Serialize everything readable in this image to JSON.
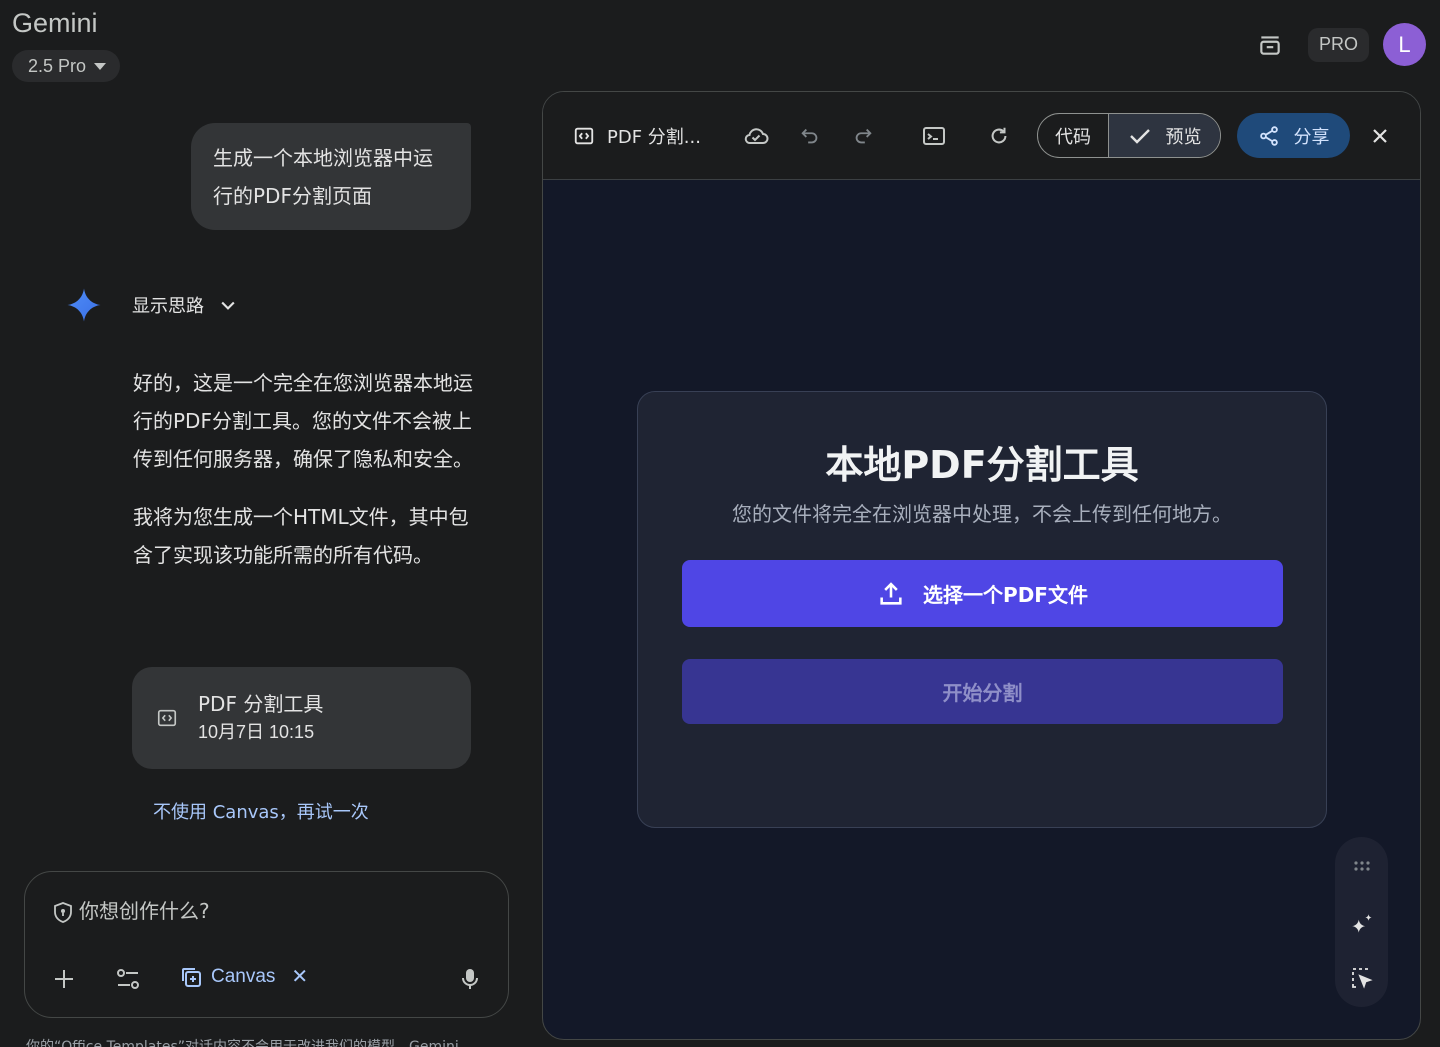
{
  "app": {
    "title": "Gemini",
    "model": "2.5 Pro",
    "pro_badge": "PRO",
    "avatar_letter": "L"
  },
  "chat": {
    "user_message": "生成一个本地浏览器中运行的PDF分割页面",
    "thoughts_label": "显示思路",
    "reply_paragraphs": [
      "好的，这是一个完全在您浏览器本地运行的PDF分割工具。您的文件不会被上传到任何服务器，确保了隐私和安全。",
      "我将为您生成一个HTML文件，其中包含了实现该功能所需的所有代码。"
    ],
    "artifact": {
      "title": "PDF 分割工具",
      "time": "10月7日 10:15"
    },
    "retry_link": "不使用 Canvas，再试一次"
  },
  "composer": {
    "placeholder": "你想创作什么?",
    "canvas_chip": "Canvas",
    "chip_close": "✕",
    "bottom_note": "你的“Office Templates”对话内容不会用于改进我们的模型。Gemini"
  },
  "canvas_panel": {
    "doc_title": "PDF 分割...",
    "tab_code": "代码",
    "tab_preview": "预览",
    "share": "分享",
    "preview": {
      "title": "本地PDF分割工具",
      "subtitle": "您的文件将完全在浏览器中处理，不会上传到任何地方。",
      "pick_button": "选择一个PDF文件",
      "split_button": "开始分割"
    }
  },
  "colors": {
    "background": "#1b1c1d",
    "accent_link": "#a8c7fa",
    "primary_button": "#4f46e5",
    "disabled_button": "#373592",
    "avatar": "#8c5fd5"
  }
}
